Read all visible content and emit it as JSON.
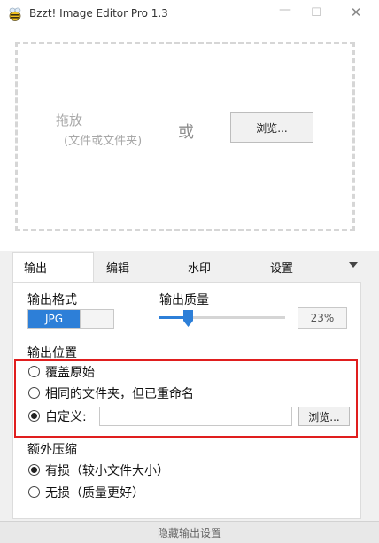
{
  "window": {
    "title": "Bzzt! Image Editor Pro 1.3",
    "app_icon": "bee-icon"
  },
  "dropzone": {
    "drag_label": "拖放",
    "drag_sub": "(文件或文件夹)",
    "or_label": "或",
    "browse_label": "浏览..."
  },
  "tabs": [
    {
      "label": "输出",
      "active": true
    },
    {
      "label": "编辑",
      "active": false
    },
    {
      "label": "水印",
      "active": false
    },
    {
      "label": "设置",
      "active": false
    }
  ],
  "output": {
    "format_label": "输出格式",
    "format_value": "JPG",
    "quality_label": "输出质量",
    "quality_value": "23%",
    "quality_fraction": 0.23,
    "location_label": "输出位置",
    "location_options": [
      {
        "label": "覆盖原始",
        "checked": false
      },
      {
        "label": "相同的文件夹，但已重命名",
        "checked": false
      },
      {
        "label": "自定义:",
        "checked": true
      }
    ],
    "custom_path_value": "",
    "browse_label": "浏览...",
    "compression_label": "额外压缩",
    "compression_options": [
      {
        "label": "有损（较小文件大小）",
        "checked": true
      },
      {
        "label": "无损（质量更好）",
        "checked": false
      }
    ]
  },
  "footer": {
    "label": "隐藏输出设置"
  },
  "colors": {
    "accent": "#2d7fd8",
    "highlight": "#e01e1e"
  }
}
